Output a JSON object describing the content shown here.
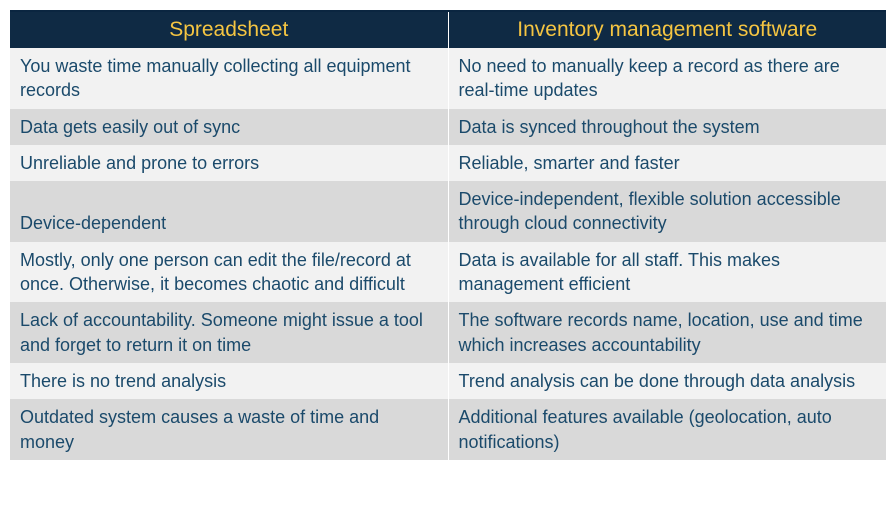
{
  "table": {
    "headers": {
      "left": "Spreadsheet",
      "right": "Inventory management software"
    },
    "rows": [
      {
        "left": "You waste time manually collecting all equipment records",
        "right": "No need to manually keep a record as there are real-time updates"
      },
      {
        "left": "Data gets easily out of sync",
        "right": "Data is synced throughout the system"
      },
      {
        "left": "Unreliable and prone to errors",
        "right": "Reliable, smarter and faster"
      },
      {
        "left": "Device-dependent",
        "right": "Device-independent, flexible solution accessible through cloud connectivity"
      },
      {
        "left": "Mostly, only one person can edit the file/record at once. Otherwise, it becomes chaotic and difficult",
        "right": "Data is available for all staff. This makes management efficient"
      },
      {
        "left": "Lack of accountability. Someone might issue a tool and forget to return it on time",
        "right": "The software records name, location, use and time which increases accountability"
      },
      {
        "left": "There is no trend analysis",
        "right": "Trend analysis can be done through data analysis"
      },
      {
        "left": "Outdated system causes a waste of time and money",
        "right": "Additional features available (geolocation, auto notifications)"
      }
    ]
  }
}
